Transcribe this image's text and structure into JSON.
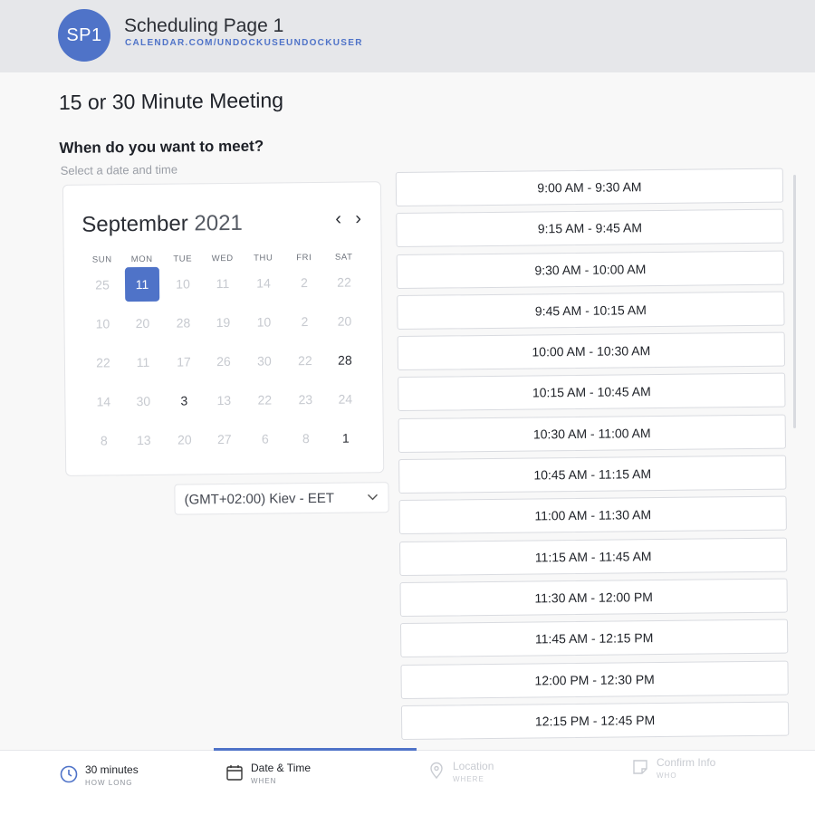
{
  "header": {
    "avatar_text": "SP1",
    "page_name": "Scheduling Page 1",
    "page_url": "CALENDAR.COM/UNDOCKUSEUNDOCKUSER"
  },
  "main": {
    "meeting_title": "15 or 30 Minute Meeting",
    "question": "When do you want to meet?",
    "hint": "Select a date and time"
  },
  "calendar": {
    "month": "September",
    "year": "2021",
    "prev_icon": "chevron-left-icon",
    "next_icon": "chevron-right-icon",
    "weekdays": [
      "SUN",
      "MON",
      "TUE",
      "WED",
      "THU",
      "FRI",
      "SAT"
    ],
    "weeks": [
      [
        "25",
        "11",
        "10",
        "11",
        "14",
        "2",
        "22"
      ],
      [
        "10",
        "20",
        "28",
        "19",
        "10",
        "2",
        "20"
      ],
      [
        "22",
        "11",
        "17",
        "26",
        "30",
        "22",
        "28"
      ],
      [
        "14",
        "30",
        "3",
        "13",
        "22",
        "23",
        "24"
      ],
      [
        "8",
        "13",
        "20",
        "27",
        "6",
        "8",
        "1"
      ]
    ],
    "selected_day": "11",
    "available_days": [
      "28",
      "3",
      "1"
    ]
  },
  "timezone": {
    "value": "(GMT+02:00) Kiev - EET",
    "icon": "chevron-down-icon"
  },
  "time_slots": [
    "9:00 AM - 9:30 AM",
    "9:15 AM - 9:45 AM",
    "9:30 AM - 10:00 AM",
    "9:45 AM - 10:15 AM",
    "10:00 AM - 10:30 AM",
    "10:15 AM - 10:45 AM",
    "10:30 AM - 11:00 AM",
    "10:45 AM - 11:15 AM",
    "11:00 AM - 11:30 AM",
    "11:15 AM - 11:45 AM",
    "11:30 AM - 12:00 PM",
    "11:45 AM - 12:15 PM",
    "12:00 PM - 12:30 PM",
    "12:15 PM - 12:45 PM"
  ],
  "footer": {
    "steps": [
      {
        "label": "30 minutes",
        "sub": "HOW LONG",
        "icon": "clock-icon"
      },
      {
        "label": "Date & Time",
        "sub": "WHEN",
        "icon": "calendar-icon"
      },
      {
        "label": "Location",
        "sub": "WHERE",
        "icon": "location-pin-icon"
      },
      {
        "label": "Confirm Info",
        "sub": "WHO",
        "icon": "note-icon"
      }
    ]
  },
  "colors": {
    "accent": "#4f73c8",
    "header_bg": "#e6e7ea",
    "page_bg": "#f8f8f8"
  }
}
